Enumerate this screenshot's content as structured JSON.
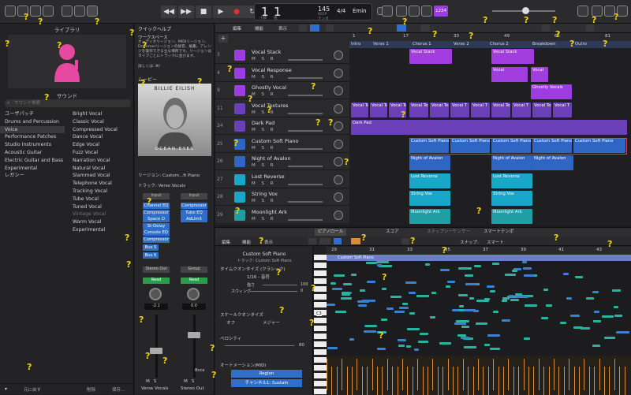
{
  "control_bar": {
    "lcd": {
      "bar": "1",
      "beat": "1",
      "bar_label": "小節",
      "beat_label": "拍",
      "tempo": "145",
      "tempo_label": "KEEP",
      "time_sig": "4/4",
      "key": "Emin",
      "tempo_sub": "テンポ"
    },
    "number_badge": "1234"
  },
  "library": {
    "header": "ライブラリ",
    "section_label": "サウンド",
    "search_placeholder": "サウンド検索",
    "categories": [
      "ユーザパッチ",
      "Drums and Percussion",
      "Voice",
      "Performance Patches",
      "Studio Instruments",
      "Acoustic Guitar",
      "Electric Guitar and Bass",
      "Experimental",
      "レガシー"
    ],
    "patches": [
      "Bright Vocal",
      "Classic Vocal",
      "Compressed Vocal",
      "Dance Vocal",
      "Edge Vocal",
      "Fuzz Vocal",
      "Narration Vocal",
      "Natural Vocal",
      "Slammed Vocal",
      "Telephone Vocal",
      "Tracking Vocal",
      "Tube Vocal",
      "Tuned Vocal",
      "Vintage Vocal",
      "Warm Vocal",
      "Experimental"
    ],
    "footer": {
      "revert": "元に戻す",
      "delete": "削除",
      "save": "保存..."
    }
  },
  "inspector": {
    "quick_help_title": "クイックヘルプ",
    "quick_help_heading": "ワークスペース",
    "quick_help_text": "オーディオリージョン、MIDIリージョン、Drummerリージョンの録音、編集、アレンジを操作できる主な場所です。リージョンはタイプごとにトラックに並びます。",
    "quick_help_more": "詳しくは: ⌘/",
    "movie_title": "ムービー",
    "album_artist": "BILLIE EILISH",
    "album_title": "OCEAN EYES",
    "region_label": "リージョン: Custom...ft Piano",
    "track_label": "トラック: Verse Vocals",
    "strip1": {
      "setting": "Input",
      "plugins": [
        "Channel EQ",
        "Compressor",
        "Space D",
        "St-Delay",
        "Console EQ",
        "Compressor"
      ],
      "sends": [
        "Bus 5",
        "Bus 6"
      ],
      "output": "Stereo Out",
      "auto": "Read",
      "pan": "-2.1",
      "name": "Verse Vocals"
    },
    "strip2": {
      "setting": "Input",
      "plugins": [
        "Compressor",
        "Tube EQ",
        "AdLimit"
      ],
      "output": "Group",
      "auto": "Read",
      "pan": "0.0",
      "name": "Stereo Out",
      "bnce": "Bnce"
    }
  },
  "tracks_header": {
    "edit": "編集",
    "function": "機能",
    "view": "表示"
  },
  "tracks": [
    {
      "num": "3",
      "name": "Vocal Stack"
    },
    {
      "num": "4",
      "name": "Vocal Response"
    },
    {
      "num": "9",
      "name": "Ghostly Vocal"
    },
    {
      "num": "11",
      "name": "Vocal Textures"
    },
    {
      "num": "24",
      "name": "Dark Pad"
    },
    {
      "num": "25",
      "name": "Custom Soft Piano"
    },
    {
      "num": "26",
      "name": "Night of Avalon"
    },
    {
      "num": "27",
      "name": "Lost Reverse"
    },
    {
      "num": "28",
      "name": "String Vox"
    },
    {
      "num": "29",
      "name": "Moonlight Ark"
    }
  ],
  "msr_label": "M S R",
  "arrange": {
    "ruler": [
      "1",
      "17",
      "33",
      "49",
      "65",
      "81"
    ],
    "markers": [
      "Intro",
      "Verse 1",
      "Chorus 1",
      "Verse 2",
      "Chorus 2",
      "Breakdown",
      "Outro"
    ]
  },
  "regions": {
    "vocal_stack": "Vocal Stack",
    "vocal": "Vocal",
    "ghostly": "Ghostly Vocals",
    "vocal_text": "Vocal Text",
    "vocal_t": "Vocal T",
    "dark_pad": "Dark Pad",
    "piano": "Custom Soft Piano",
    "avalon": "Night of Avalon",
    "lost": "Lost Reverse",
    "string": "String Vox",
    "moon": "Moonlight Ark"
  },
  "piano_roll": {
    "tabs": [
      "ピアノロール",
      "スコア",
      "ステップシーケンサー",
      "スマートテンポ"
    ],
    "edit": "編集",
    "function": "機能",
    "view": "表示",
    "snap_label": "スナップ:",
    "snap_value": "スマート",
    "region_name": "Custom Soft Piano",
    "track_name": "トラック: Custom Soft Piano",
    "ruler": [
      "29",
      "31",
      "33",
      "35",
      "37",
      "39",
      "41",
      "43"
    ],
    "quantize_label": "タイムクオンタイズ (クラシック)",
    "quantize_value": "1/16 - 音符",
    "strength_label": "強さ",
    "strength_value": "100",
    "swing_label": "スウィング",
    "swing_value": "0",
    "scale_label": "スケールクオンタイズ",
    "scale_off": "オフ",
    "scale_type": "メジャー",
    "velocity_label": "ベロシティ",
    "velocity_value": "80",
    "automation_label": "オートメーション/MIDI",
    "region_btn": "Region",
    "channel_btn": "チャンネル1: Sustain",
    "c3": "C3",
    "region_bar": "Custom Soft Piano"
  },
  "colors": {
    "accent": "#2f6ec9",
    "purple": "#9b3de0",
    "violet": "#6a3fb8",
    "blue": "#2f66c4",
    "cyan": "#19a7c9",
    "teal": "#1f9ea6",
    "note": "#2bb3a0",
    "orange": "#d98b3a",
    "question": "#f3d400"
  }
}
